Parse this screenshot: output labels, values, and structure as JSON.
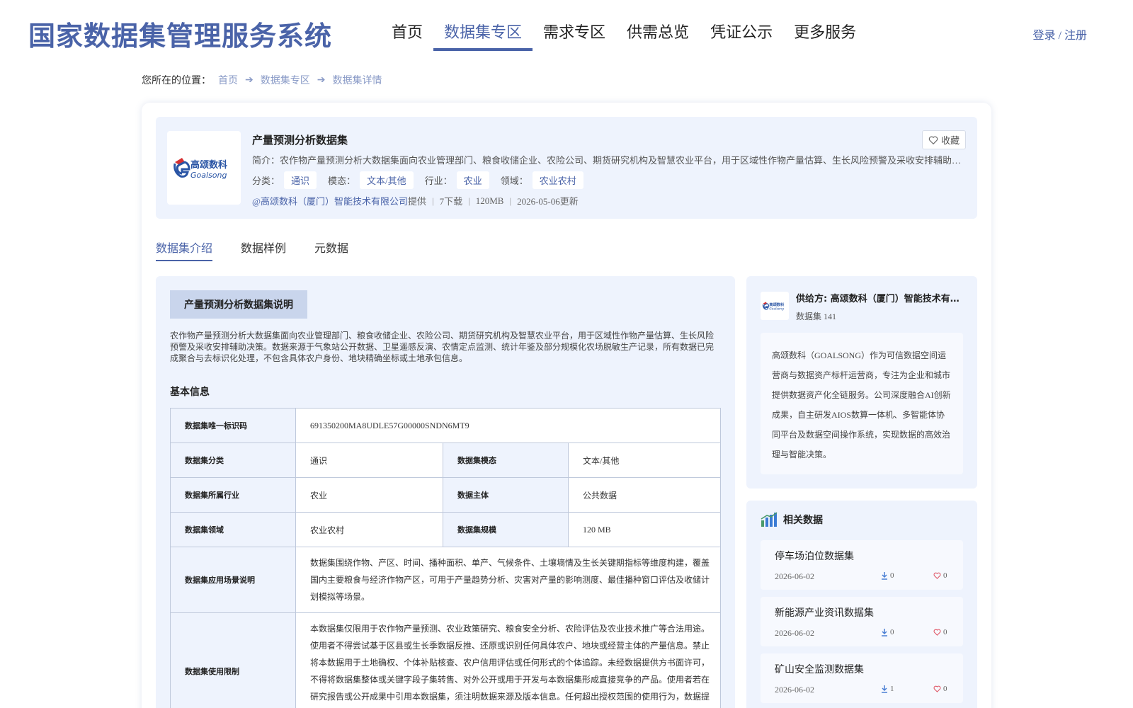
{
  "header": {
    "site_title": "国家数据集管理服务系统",
    "nav": [
      "首页",
      "数据集专区",
      "需求专区",
      "供需总览",
      "凭证公示",
      "更多服务"
    ],
    "active_nav": "数据集专区",
    "login_label": "登录 / 注册"
  },
  "breadcrumb": {
    "prefix": "您所在的位置：",
    "items": [
      "首页",
      "数据集专区",
      "数据集详情"
    ]
  },
  "dataset": {
    "logo_text_cn": "高颂数科",
    "logo_text_en": "Goalsong",
    "title": "产量预测分析数据集",
    "intro": "简介：农作物产量预测分析大数据集面向农业管理部门、粮食收储企业、农险公司、期货研究机构及智慧农业平台，用于区域性作物产量估算、生长风险预警及采收安排辅助决策。数据来源于气象站公开数据、卫星遥感反演、农情定点监测、统计年鉴及部分规模化农场脱敏生产记录。",
    "fav_label": "收藏",
    "tags": {
      "category_label": "分类：",
      "category": "通识",
      "modality_label": "模态：",
      "modality": "文本/其他",
      "industry_label": "行业：",
      "industry": "农业",
      "domain_label": "领域：",
      "domain": "农业农村"
    },
    "meta": {
      "provider": "@高颂数科（厦门）智能技术有限公司",
      "provider_suffix": "提供",
      "downloads": "7下载",
      "size": "120MB",
      "updated": "2026-05-06更新"
    }
  },
  "tabs": [
    "数据集介绍",
    "数据样例",
    "元数据"
  ],
  "description": {
    "heading": "产量预测分析数据集说明",
    "text": "农作物产量预测分析大数据集面向农业管理部门、粮食收储企业、农险公司、期货研究机构及智慧农业平台，用于区域性作物产量估算、生长风险预警及采收安排辅助决策。数据来源于气象站公开数据、卫星遥感反演、农情定点监测、统计年鉴及部分规模化农场脱敏生产记录，所有数据已完成聚合与去标识化处理，不包含具体农户身份、地块精确坐标或土地承包信息。"
  },
  "basic_info": {
    "title": "基本信息",
    "id_label": "数据集唯一标识码",
    "id_value": "691350200MA8UDLE57G00000SNDN6MT9",
    "category_label": "数据集分类",
    "category_value": "通识",
    "modality_label": "数据集模态",
    "modality_value": "文本/其他",
    "industry_label": "数据集所属行业",
    "industry_value": "农业",
    "subject_label": "数据主体",
    "subject_value": "公共数据",
    "domain_label": "数据集领域",
    "domain_value": "农业农村",
    "scale_label": "数据集规模",
    "scale_value": "120 MB",
    "scenario_label": "数据集应用场景说明",
    "scenario_value": "数据集围绕作物、产区、时间、播种面积、单产、气候条件、土壤墒情及生长关键期指标等维度构建，覆盖国内主要粮食与经济作物产区，可用于产量趋势分析、灾害对产量的影响测度、最佳播种窗口评估及收储计划模拟等场景。",
    "restriction_label": "数据集使用限制",
    "restriction_value": "本数据集仅限用于农作物产量预测、农业政策研究、粮食安全分析、农险评估及农业技术推广等合法用途。使用者不得尝试基于区县或生长季数据反推、还原或识别任何具体农户、地块或经营主体的产量信息。禁止将本数据用于土地确权、个体补贴核查、农户信用评估或任何形式的个体追踪。未经数据提供方书面许可，不得将数据集整体或关键字段子集转售、对外公开或用于开发与本数据集形成直接竞争的产品。使用者若在研究报告或公开成果中引用本数据集，须注明数据来源及版本信息。任何超出授权范围的使用行为，数据提供方保留追"
  },
  "supplier": {
    "name": "供给方: 高颂数科（厦门）智能技术有限公司",
    "count": "数据集 141",
    "description": "高颂数科（GOALSONG）作为可信数据空间运营商与数据资产标杆运营商，专注为企业和城市提供数据资产化全链服务。公司深度融合AI创新成果，自主研发AIOS数算一体机、多智能体协同平台及数据空间操作系统，实现数据的高效治理与智能决策。"
  },
  "related": {
    "title": "相关数据",
    "items": [
      {
        "name": "停车场泊位数据集",
        "date": "2026-06-02",
        "downloads": "0",
        "likes": "0"
      },
      {
        "name": "新能源产业资讯数据集",
        "date": "2026-06-02",
        "downloads": "0",
        "likes": "0"
      },
      {
        "name": "矿山安全监测数据集",
        "date": "2026-06-02",
        "downloads": "1",
        "likes": "0"
      }
    ]
  },
  "colors": {
    "brand": "#4a63a8",
    "panel_bg": "#eef3fd",
    "heading_bg": "#c9d5ec",
    "logo_red": "#d63031",
    "logo_blue": "#2a55a5"
  }
}
